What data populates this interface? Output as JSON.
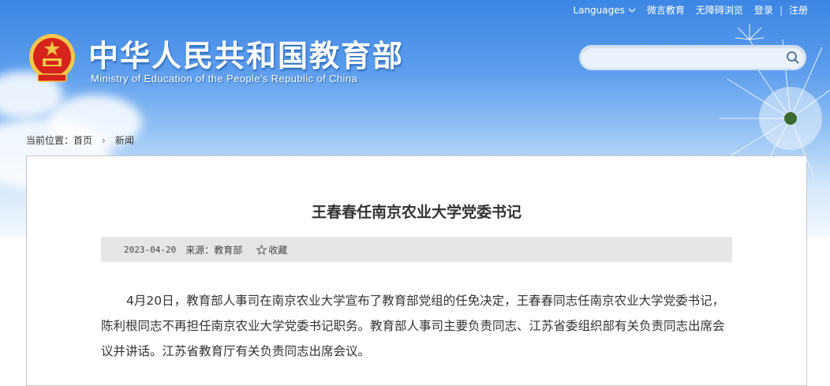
{
  "topnav": {
    "languages": "Languages",
    "items": [
      "微言教育",
      "无障碍浏览",
      "登录",
      "注册"
    ]
  },
  "site": {
    "title_cn": "中华人民共和国教育部",
    "title_en": "Ministry of Education of the People's Republic of China"
  },
  "search": {
    "placeholder": "",
    "value": ""
  },
  "breadcrumb": {
    "prefix": "当前位置：",
    "home": "首页",
    "current": "新闻"
  },
  "article": {
    "title": "王春春任南京农业大学党委书记",
    "date": "2023-04-20",
    "source": "来源：教育部",
    "favorite": "收藏",
    "body": "4月20日，教育部人事司在南京农业大学宣布了教育部党组的任免决定，王春春同志任南京农业大学党委书记，陈利根同志不再担任南京农业大学党委书记职务。教育部人事司主要负责同志、江苏省委组织部有关负责同志出席会议并讲话。江苏省教育厅有关负责同志出席会议。"
  },
  "colors": {
    "sky_top": "#3c86e4",
    "emblem_red": "#d6241c",
    "emblem_gold": "#f5c64a",
    "meta_bar": "#e6e6e6"
  },
  "icons": [
    "chevron-down-icon",
    "search-icon",
    "star-icon",
    "national-emblem-icon"
  ]
}
